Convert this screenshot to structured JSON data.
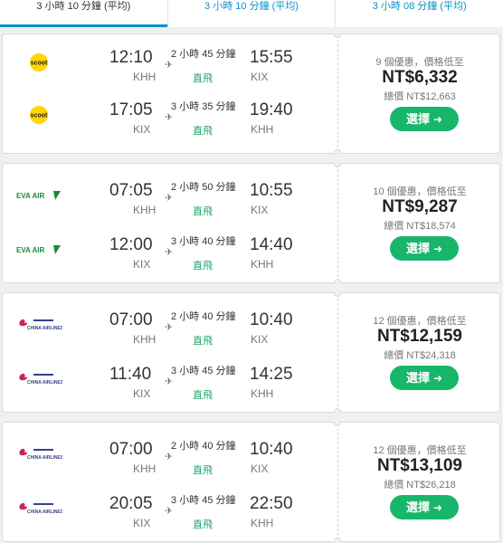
{
  "tabs": [
    {
      "label": "3 小時 10 分鐘 (平均)",
      "active": true
    },
    {
      "label": "3 小時 10 分鐘 (平均)",
      "active": false
    },
    {
      "label": "3 小時 08 分鐘 (平均)",
      "active": false
    }
  ],
  "direct_label": "直飛",
  "select_label": "選擇",
  "arrow_icon": "➜",
  "plane_icon": "✈",
  "cards": [
    {
      "airline": "scoot",
      "legs": [
        {
          "dep_time": "12:10",
          "dep_code": "KHH",
          "arr_time": "15:55",
          "arr_code": "KIX",
          "duration": "2 小時 45 分鐘"
        },
        {
          "dep_time": "17:05",
          "dep_code": "KIX",
          "arr_time": "19:40",
          "arr_code": "KHH",
          "duration": "3 小時 35 分鐘"
        }
      ],
      "deals": "9 個優惠，價格低至",
      "price": "NT$6,332",
      "total": "總價 NT$12,663"
    },
    {
      "airline": "EVA AIR",
      "legs": [
        {
          "dep_time": "07:05",
          "dep_code": "KHH",
          "arr_time": "10:55",
          "arr_code": "KIX",
          "duration": "2 小時 50 分鐘"
        },
        {
          "dep_time": "12:00",
          "dep_code": "KIX",
          "arr_time": "14:40",
          "arr_code": "KHH",
          "duration": "3 小時 40 分鐘"
        }
      ],
      "deals": "10 個優惠，價格低至",
      "price": "NT$9,287",
      "total": "總價 NT$18,574"
    },
    {
      "airline": "CHINA AIRLINES",
      "legs": [
        {
          "dep_time": "07:00",
          "dep_code": "KHH",
          "arr_time": "10:40",
          "arr_code": "KIX",
          "duration": "2 小時 40 分鐘"
        },
        {
          "dep_time": "11:40",
          "dep_code": "KIX",
          "arr_time": "14:25",
          "arr_code": "KHH",
          "duration": "3 小時 45 分鐘"
        }
      ],
      "deals": "12 個優惠，價格低至",
      "price": "NT$12,159",
      "total": "總價 NT$24,318"
    },
    {
      "airline": "CHINA AIRLINES",
      "legs": [
        {
          "dep_time": "07:00",
          "dep_code": "KHH",
          "arr_time": "10:40",
          "arr_code": "KIX",
          "duration": "2 小時 40 分鐘"
        },
        {
          "dep_time": "20:05",
          "dep_code": "KIX",
          "arr_time": "22:50",
          "arr_code": "KHH",
          "duration": "3 小時 45 分鐘"
        }
      ],
      "deals": "12 個優惠，價格低至",
      "price": "NT$13,109",
      "total": "總價 NT$26,218"
    }
  ],
  "colors": {
    "accent": "#0a92c7",
    "green": "#18b66b",
    "scoot_yellow": "#ffd600",
    "eva_green": "#1a8a3c",
    "china_pink": "#c8265b",
    "china_blue": "#3a3f8f"
  }
}
